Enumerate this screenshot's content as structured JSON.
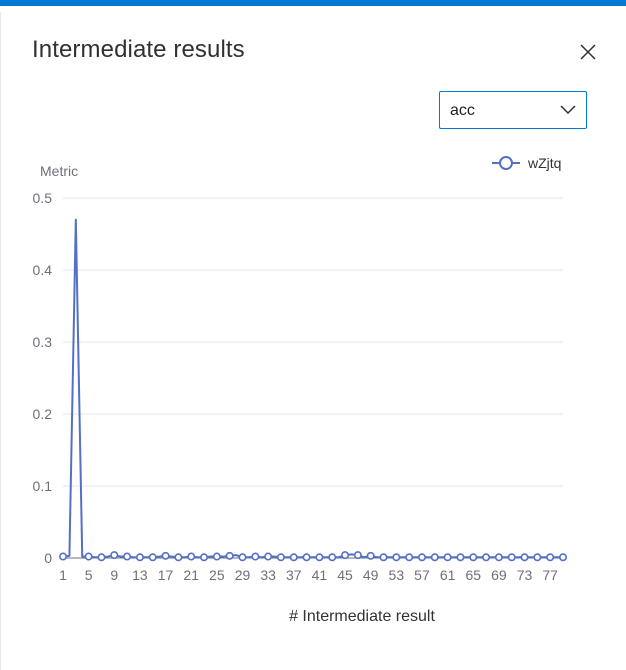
{
  "dialog": {
    "title": "Intermediate results",
    "close_icon": "close-icon"
  },
  "metric_select": {
    "selected": "acc",
    "icon": "chevron-down-icon"
  },
  "colors": {
    "accent": "#0078d4",
    "series": "#5470c6",
    "grid": "#e0e6f1",
    "axis_text": "#6e7079"
  },
  "chart_data": {
    "type": "line",
    "ylabel": "Metric",
    "xlabel": "# Intermediate result",
    "ylim": [
      0,
      0.5
    ],
    "yticks": [
      0,
      0.1,
      0.2,
      0.3,
      0.4,
      0.5
    ],
    "xticks": [
      1,
      5,
      9,
      13,
      17,
      21,
      25,
      29,
      33,
      37,
      41,
      45,
      49,
      53,
      57,
      61,
      65,
      69,
      73,
      77
    ],
    "legend": "top-right",
    "grid": true,
    "series": [
      {
        "name": "wZjtq",
        "x": [
          1,
          2,
          3,
          4,
          5,
          6,
          7,
          8,
          9,
          10,
          11,
          12,
          13,
          14,
          15,
          16,
          17,
          18,
          19,
          20,
          21,
          22,
          23,
          24,
          25,
          26,
          27,
          28,
          29,
          30,
          31,
          32,
          33,
          34,
          35,
          36,
          37,
          38,
          39,
          40,
          41,
          42,
          43,
          44,
          45,
          46,
          47,
          48,
          49,
          50,
          51,
          52,
          53,
          54,
          55,
          56,
          57,
          58,
          59,
          60,
          61,
          62,
          63,
          64,
          65,
          66,
          67,
          68,
          69,
          70,
          71,
          72,
          73,
          74,
          75,
          76,
          77,
          78,
          79
        ],
        "values": [
          0.002,
          0.003,
          0.47,
          0.002,
          0.002,
          0.001,
          0.001,
          0.002,
          0.004,
          0.002,
          0.002,
          0.001,
          0.001,
          0.001,
          0.001,
          0.002,
          0.003,
          0.002,
          0.001,
          0.001,
          0.002,
          0.001,
          0.001,
          0.002,
          0.002,
          0.002,
          0.003,
          0.004,
          0.001,
          0.001,
          0.002,
          0.001,
          0.002,
          0.002,
          0.001,
          0.001,
          0.001,
          0.001,
          0.001,
          0.001,
          0.001,
          0.001,
          0.001,
          0.001,
          0.004,
          0.005,
          0.004,
          0.001,
          0.003,
          0.001,
          0.001,
          0.001,
          0.001,
          0.001,
          0.001,
          0.001,
          0.001,
          0.001,
          0.001,
          0.001,
          0.001,
          0.001,
          0.001,
          0.001,
          0.001,
          0.001,
          0.001,
          0.001,
          0.001,
          0.001,
          0.001,
          0.001,
          0.001,
          0.001,
          0.001,
          0.001,
          0.001,
          0.001,
          0.001
        ]
      }
    ]
  }
}
